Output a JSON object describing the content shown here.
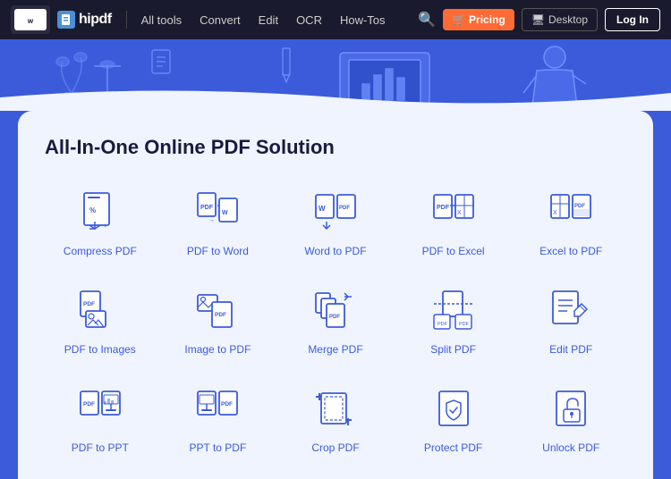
{
  "navbar": {
    "brand": "hipdf",
    "nav_items": [
      {
        "label": "All tools",
        "id": "all-tools"
      },
      {
        "label": "Convert",
        "id": "convert"
      },
      {
        "label": "Edit",
        "id": "edit"
      },
      {
        "label": "OCR",
        "id": "ocr"
      },
      {
        "label": "How-Tos",
        "id": "how-tos"
      }
    ],
    "pricing_label": "Pricing",
    "desktop_label": "Desktop",
    "login_label": "Log In"
  },
  "main": {
    "title": "All-In-One Online PDF Solution",
    "tools": [
      {
        "id": "compress-pdf",
        "label": "Compress PDF",
        "icon": "compress"
      },
      {
        "id": "pdf-to-word",
        "label": "PDF to Word",
        "icon": "pdf-to-word"
      },
      {
        "id": "word-to-pdf",
        "label": "Word to PDF",
        "icon": "word-to-pdf"
      },
      {
        "id": "pdf-to-excel",
        "label": "PDF to Excel",
        "icon": "pdf-to-excel"
      },
      {
        "id": "excel-to-pdf",
        "label": "Excel to PDF",
        "icon": "excel-to-pdf"
      },
      {
        "id": "pdf-to-images",
        "label": "PDF to Images",
        "icon": "pdf-to-images"
      },
      {
        "id": "image-to-pdf",
        "label": "Image to PDF",
        "icon": "image-to-pdf"
      },
      {
        "id": "merge-pdf",
        "label": "Merge PDF",
        "icon": "merge"
      },
      {
        "id": "split-pdf",
        "label": "Split PDF",
        "icon": "split"
      },
      {
        "id": "edit-pdf",
        "label": "Edit PDF",
        "icon": "edit"
      },
      {
        "id": "pdf-to-ppt",
        "label": "PDF to PPT",
        "icon": "pdf-to-ppt"
      },
      {
        "id": "ppt-to-pdf",
        "label": "PPT to PDF",
        "icon": "ppt-to-pdf"
      },
      {
        "id": "crop-pdf",
        "label": "Crop PDF",
        "icon": "crop"
      },
      {
        "id": "protect-pdf",
        "label": "Protect PDF",
        "icon": "protect"
      },
      {
        "id": "unlock-pdf",
        "label": "Unlock PDF",
        "icon": "unlock"
      }
    ]
  }
}
